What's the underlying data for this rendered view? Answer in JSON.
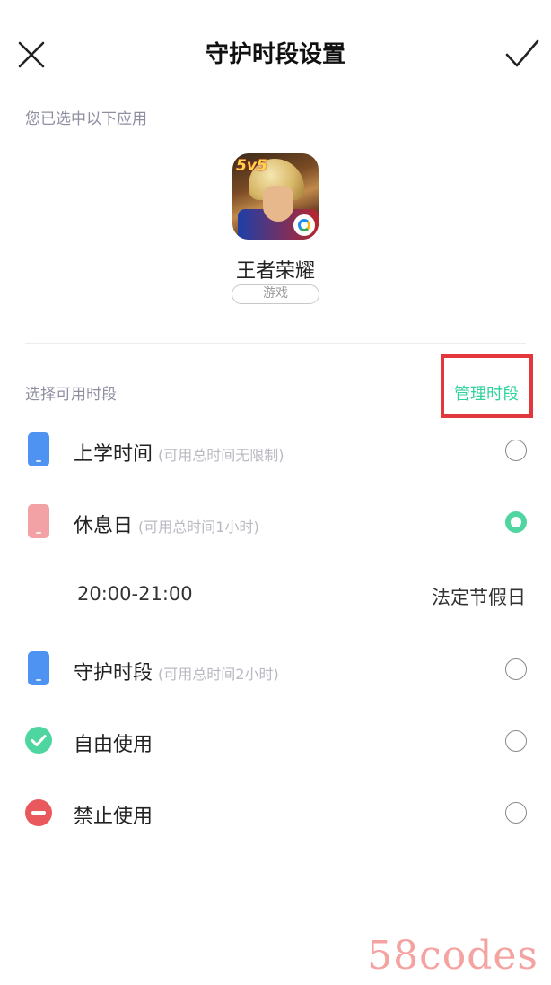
{
  "nav": {
    "title": "守护时段设置",
    "close_icon": "close-icon",
    "confirm_icon": "check-icon"
  },
  "selected_apps": {
    "label": "您已选中以下应用",
    "app": {
      "name": "王者荣耀",
      "category": "游戏",
      "icon_badge": "5v5"
    }
  },
  "time_slots": {
    "label": "选择可用时段",
    "manage_label": "管理时段",
    "highlight_color": "#e2383d",
    "accent_color": "#2fd39b",
    "items": [
      {
        "title": "上学时间",
        "note": "(可用总时间无限制)",
        "icon": "phone-icon",
        "color": "#4f93f2",
        "selected": false
      },
      {
        "title": "休息日",
        "note": "(可用总时间1小时)",
        "icon": "phone-icon",
        "color": "#f2a1a4",
        "selected": true,
        "detail": {
          "time_range": "20:00-21:00",
          "day_type": "法定节假日"
        }
      },
      {
        "title": "守护时段",
        "note": "(可用总时间2小时)",
        "icon": "phone-icon",
        "color": "#4f93f2",
        "selected": false
      },
      {
        "title": "自由使用",
        "note": "",
        "icon": "check-circle-icon",
        "color": "#4fd5a0",
        "selected": false
      },
      {
        "title": "禁止使用",
        "note": "",
        "icon": "minus-circle-icon",
        "color": "#e8585d",
        "selected": false
      }
    ]
  },
  "watermark": "58codes"
}
